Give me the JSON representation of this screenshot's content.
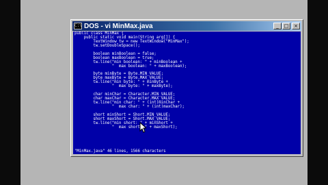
{
  "window": {
    "title": "DOS - vi MinMax.java",
    "system_icon": "C:\\",
    "minimize_glyph": "_",
    "maximize_glyph": "□",
    "close_glyph": "×"
  },
  "editor": {
    "lines": [
      "public class MinMax {",
      "    public static void main(String arg[]) {",
      "        TextWindow tw = new TextWindow(\"MinMax\");",
      "        tw.setDoubleSpace();",
      "",
      "        boolean minBoolean = false;",
      "        boolean maxBoolean = true;",
      "        tw.line(\"min boolean: \" + minBoolean +",
      "                \"  max boolean: \" + maxBoolean);",
      "",
      "        byte minByte = Byte.MIN_VALUE;",
      "        byte maxByte = Byte.MAX_VALUE;",
      "        tw.line(\"min byte: \" + minByte +",
      "                \"  max byte: \" + maxByte);",
      "",
      "        char minChar = Character.MIN_VALUE;",
      "        char maxChar = Character.MAX_VALUE;",
      "        tw.line(\"min char: \" + (int)minChar +",
      "                \"  max char: \" + (int)maxChar);",
      "",
      "        short minShort = Short.MIN_VALUE;",
      "        short maxShort = Short.MAX_VALUE;",
      "        tw.line(\"min short: \" + minShort +",
      "                \"  max short: \" + maxShort);"
    ],
    "status": "\"MinMax.java\" 46 lines, 1566 characters"
  }
}
